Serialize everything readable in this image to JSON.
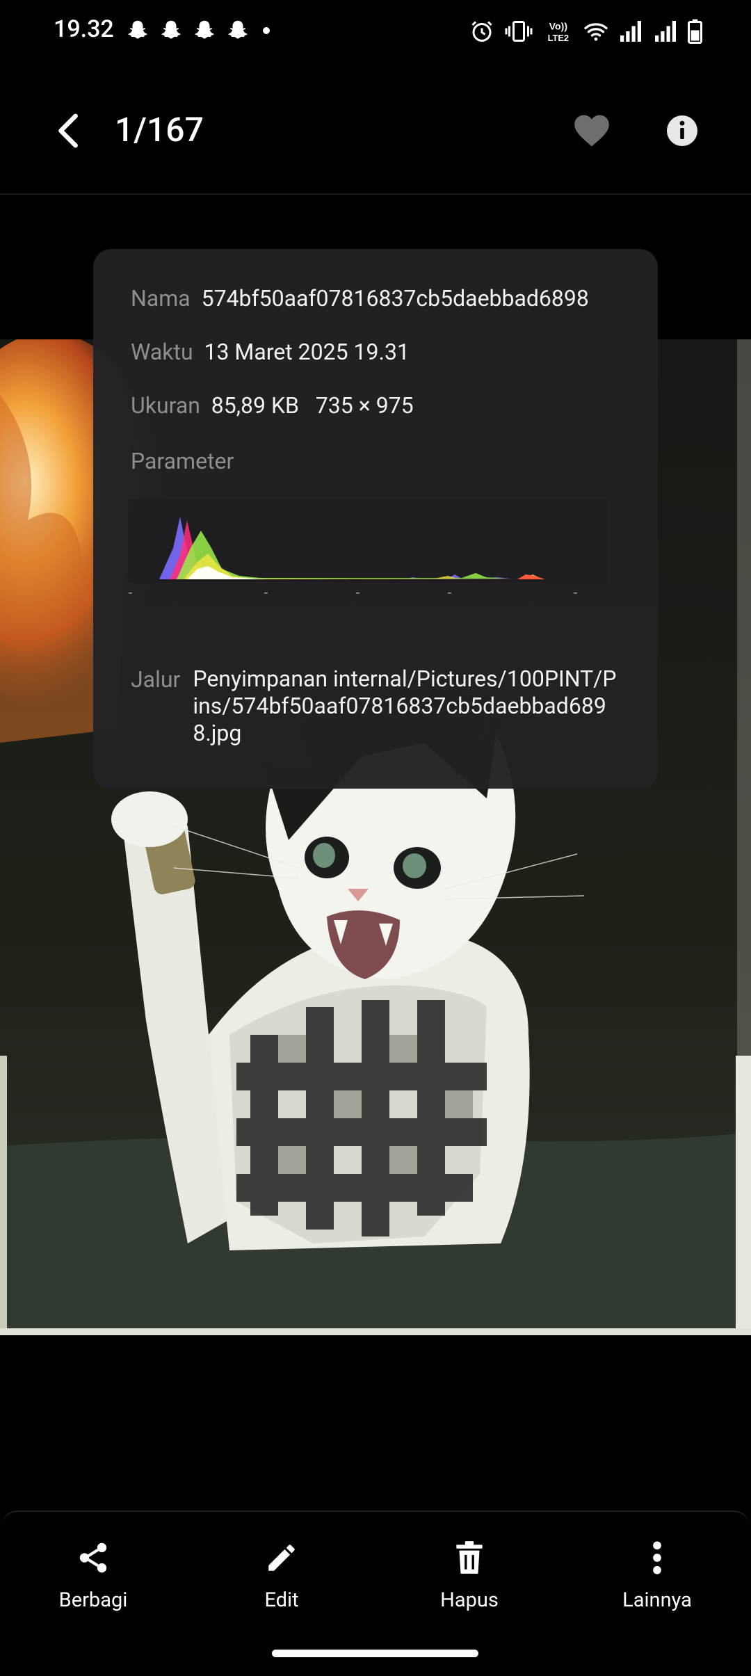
{
  "status_bar": {
    "time": "19.32",
    "notification_icons": [
      "snapchat-icon",
      "snapchat-icon",
      "snapchat-icon",
      "snapchat-icon"
    ],
    "system_icons": [
      "alarm-icon",
      "vibrate-icon",
      "volte-icon",
      "wifi-icon",
      "signal-icon",
      "signal-icon",
      "battery-icon"
    ],
    "volte_label_top": "Vo))",
    "volte_label_bottom": "LTE2"
  },
  "top_bar": {
    "counter": "1/167",
    "back_icon": "chevron-left-icon",
    "favorite_icon": "heart-icon",
    "info_icon": "info-icon"
  },
  "info_panel": {
    "name_label": "Nama",
    "name_value": "574bf50aaf07816837cb5daebbad6898",
    "time_label": "Waktu",
    "time_value": "13 Maret 2025 19.31",
    "size_label": "Ukuran",
    "size_value": "85,89 KB",
    "dimensions_value": "735 × 975",
    "parameter_label": "Parameter",
    "histogram_ticks": [
      "-",
      "-",
      "-",
      "-",
      "-"
    ],
    "path_label": "Jalur",
    "path_value": "Penyimpanan internal/Pictures/100PINT/Pins/574bf50aaf07816837cb5daebbad6898.jpg"
  },
  "bottom_bar": {
    "share_label": "Berbagi",
    "edit_label": "Edit",
    "delete_label": "Hapus",
    "more_label": "Lainnya"
  },
  "colors": {
    "background": "#000000",
    "panel": "#222224",
    "label_gray": "#8e8e93",
    "text": "#f2f2f2"
  }
}
